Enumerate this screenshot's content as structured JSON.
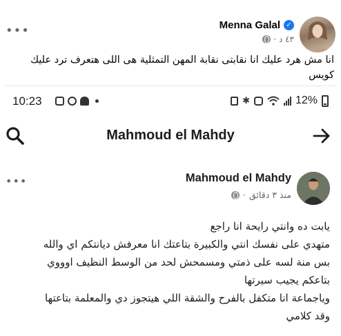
{
  "outer_post": {
    "author": "Menna Galal",
    "verified_icon": "verified-badge-icon",
    "meta_time": "٤٣ د",
    "meta_separator": "·",
    "audience_icon": "globe-icon",
    "more_label": "•••",
    "text": "انا مش هرد  عليك انا نقابتى نقابة المهن التمثلية هى اللى هتعرف ترد عليك كويس"
  },
  "status_bar": {
    "time": "10:23",
    "battery_percent": "12%",
    "left_icons": [
      "message-icon",
      "whatsapp-icon",
      "snapchat-icon",
      "dot-icon"
    ],
    "right_icons": [
      "battery-saver-icon",
      "bluetooth-icon",
      "nfc-icon",
      "wifi-icon",
      "signal-icon",
      "battery-icon"
    ]
  },
  "nav": {
    "title": "Mahmoud el Mahdy",
    "search_icon": "search-icon",
    "forward_icon": "arrow-right-icon"
  },
  "inner_post": {
    "author": "Mahmoud el Mahdy",
    "meta_time": "منذ ٣ دقائق",
    "meta_separator": "·",
    "audience_icon": "globe-icon",
    "more_label": "•••",
    "lines": [
      "يابت ده وانتي رايحة انا راجع",
      "متهدي على نفسك انتي والكبيرة بتاعتك انا معرفش ديانتكم اي والله",
      "بس منة لسه على ذمتي ومسمحش لحد من الوسط النظيف اوووي",
      "بتاعكم يجيب سيرتها",
      "وياجماعة انا متكفل بالفرح والشقة اللي هيتجوز دي والمعلمة بتاعتها",
      "وقد كلامي"
    ]
  }
}
